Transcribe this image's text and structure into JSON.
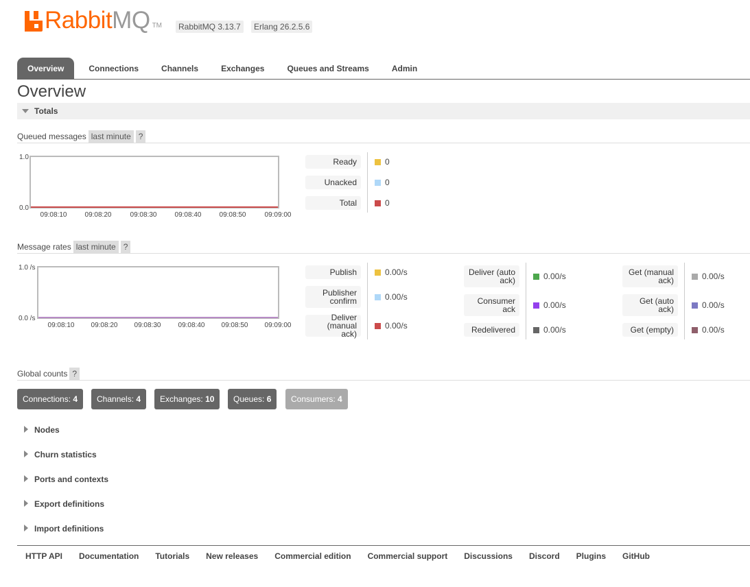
{
  "app": {
    "logo_text": "RabbitMQ",
    "logo_primary": "Rabbit",
    "logo_secondary": "MQ",
    "logo_tm": "TM",
    "brand_color": "#ff6600",
    "rabbitmq_version": "RabbitMQ 3.13.7",
    "erlang_version": "Erlang 26.2.5.6"
  },
  "tabs": [
    {
      "label": "Overview",
      "active": true
    },
    {
      "label": "Connections"
    },
    {
      "label": "Channels"
    },
    {
      "label": "Exchanges"
    },
    {
      "label": "Queues and Streams"
    },
    {
      "label": "Admin"
    }
  ],
  "page_title": "Overview",
  "totals": {
    "section_label": "Totals",
    "queued": {
      "label": "Queued messages",
      "range": "last minute",
      "help": "?",
      "y_max": "1.0",
      "y_min": "0.0",
      "x_ticks": [
        "09:08:10",
        "09:08:20",
        "09:08:30",
        "09:08:40",
        "09:08:50",
        "09:09:00"
      ],
      "legend": [
        {
          "label": "Ready",
          "value": "0",
          "color": "#edc240"
        },
        {
          "label": "Unacked",
          "value": "0",
          "color": "#afd8f8"
        },
        {
          "label": "Total",
          "value": "0",
          "color": "#cb4b4b"
        }
      ]
    },
    "rates": {
      "label": "Message rates",
      "range": "last minute",
      "help": "?",
      "y_max": "1.0 /s",
      "y_min": "0.0 /s",
      "x_ticks": [
        "09:08:10",
        "09:08:20",
        "09:08:30",
        "09:08:40",
        "09:08:50",
        "09:09:00"
      ],
      "col1": [
        {
          "label": "Publish",
          "value": "0.00/s",
          "color": "#edc240"
        },
        {
          "label": "Publisher confirm",
          "value": "0.00/s",
          "color": "#afd8f8"
        },
        {
          "label": "Deliver (manual ack)",
          "value": "0.00/s",
          "color": "#cb4b4b"
        }
      ],
      "col2": [
        {
          "label": "Deliver (auto ack)",
          "value": "0.00/s",
          "color": "#4da74d"
        },
        {
          "label": "Consumer ack",
          "value": "0.00/s",
          "color": "#9440ed"
        },
        {
          "label": "Redelivered",
          "value": "0.00/s",
          "color": "#666666"
        }
      ],
      "col3": [
        {
          "label": "Get (manual ack)",
          "value": "0.00/s",
          "color": "#aaaaaa"
        },
        {
          "label": "Get (auto ack)",
          "value": "0.00/s",
          "color": "#7c79c3"
        },
        {
          "label": "Get (empty)",
          "value": "0.00/s",
          "color": "#8f5f6b"
        }
      ]
    }
  },
  "global_counts": {
    "label": "Global counts",
    "help": "?",
    "items": [
      {
        "label": "Connections:",
        "value": "4"
      },
      {
        "label": "Channels:",
        "value": "4"
      },
      {
        "label": "Exchanges:",
        "value": "10"
      },
      {
        "label": "Queues:",
        "value": "6"
      },
      {
        "label": "Consumers:",
        "value": "4"
      }
    ]
  },
  "sections": [
    "Nodes",
    "Churn statistics",
    "Ports and contexts",
    "Export definitions",
    "Import definitions"
  ],
  "footer": [
    "HTTP API",
    "Documentation",
    "Tutorials",
    "New releases",
    "Commercial edition",
    "Commercial support",
    "Discussions",
    "Discord",
    "Plugins",
    "GitHub"
  ]
}
